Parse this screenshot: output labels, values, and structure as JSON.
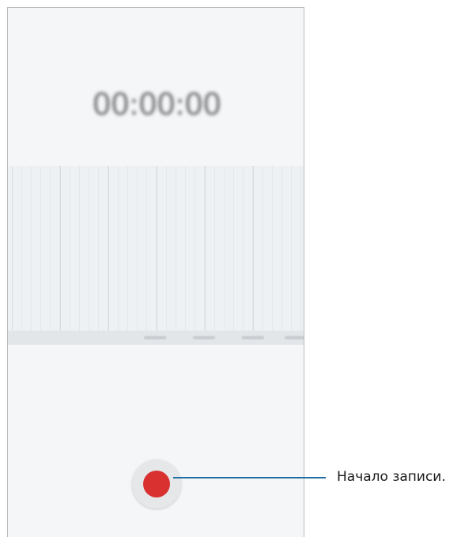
{
  "recorder": {
    "timer": "00:00:00"
  },
  "record_button": {
    "color": "#d93030"
  },
  "callout": {
    "label": "Начало записи.",
    "line_color": "#1d6fa3"
  }
}
